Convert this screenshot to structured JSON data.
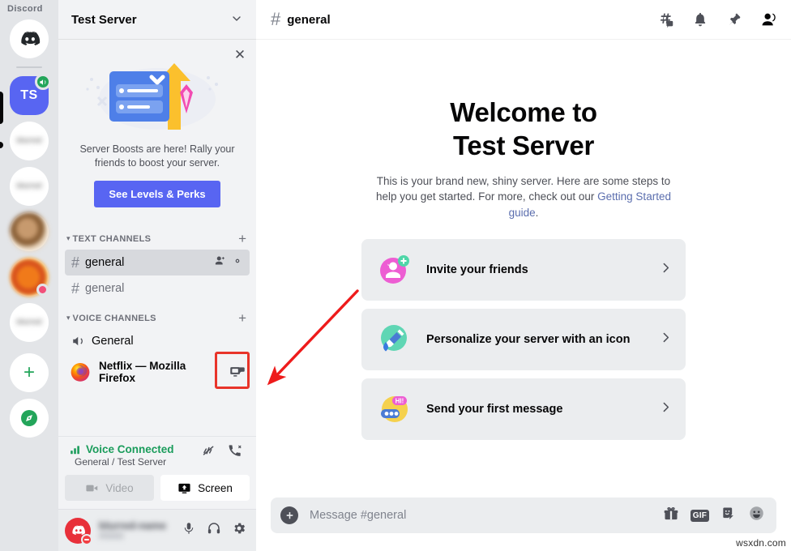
{
  "watermark": {
    "brand": "Discord",
    "source": "wsxdn.com"
  },
  "server_rail": {
    "items": [
      {
        "name": "home",
        "label": "",
        "type": "discord-home"
      },
      {
        "name": "test-server",
        "label": "TS",
        "type": "tile",
        "voice_active": true
      },
      {
        "name": "server-2",
        "label": "blurred",
        "type": "blurred"
      },
      {
        "name": "server-3",
        "label": "blurred",
        "type": "blurred"
      },
      {
        "name": "server-4",
        "label": "",
        "type": "photo-a"
      },
      {
        "name": "server-5",
        "label": "",
        "type": "photo-b"
      },
      {
        "name": "server-6",
        "label": "blurred",
        "type": "blurred"
      }
    ],
    "add_server_label": "+",
    "explore_label": "explore-icon"
  },
  "sidebar": {
    "server_name": "Test Server",
    "promo": {
      "text": "Server Boosts are here! Rally your friends to boost your server.",
      "button_label": "See Levels & Perks",
      "close_label": "✕"
    },
    "categories": [
      {
        "label": "TEXT CHANNELS",
        "add_label": "+",
        "channels": [
          {
            "name": "general",
            "type": "text",
            "active": true
          },
          {
            "name": "general",
            "type": "text",
            "active": false
          }
        ]
      },
      {
        "label": "VOICE CHANNELS",
        "add_label": "+",
        "channels": [
          {
            "name": "General",
            "type": "voice",
            "active": false
          }
        ]
      }
    ],
    "app_row": {
      "app_name": "Netflix — Mozilla Firefox",
      "share_icon": "screen-share-icon"
    },
    "voice_panel": {
      "status": "Voice Connected",
      "location": "General / Test Server",
      "video_label": "Video",
      "screen_label": "Screen"
    },
    "user_panel": {
      "username": "blurred-name",
      "tag": "#0000"
    }
  },
  "main": {
    "channel_name": "general",
    "channel_hash": "#",
    "topbar_icons": [
      "threads-icon",
      "bell-icon",
      "pin-icon",
      "members-icon"
    ],
    "welcome_line1": "Welcome to",
    "welcome_line2": "Test Server",
    "description_before": "This is your brand new, shiny server. Here are some steps to help you get started. For more, check out our ",
    "description_link": "Getting Started guide",
    "description_after": ".",
    "cards": [
      {
        "label": "Invite your friends",
        "icon": "invite-friends-icon"
      },
      {
        "label": "Personalize your server with an icon",
        "icon": "paintbrush-icon"
      },
      {
        "label": "Send your first message",
        "icon": "chat-bubble-icon"
      }
    ],
    "message_placeholder": "Message #general",
    "message_value": "",
    "message_icons": [
      "gift-icon",
      "GIF",
      "sticker-icon",
      "emoji-icon"
    ]
  },
  "annotation": {
    "arrow_color": "#ee1b1b",
    "highlight_color": "#e8342a"
  }
}
